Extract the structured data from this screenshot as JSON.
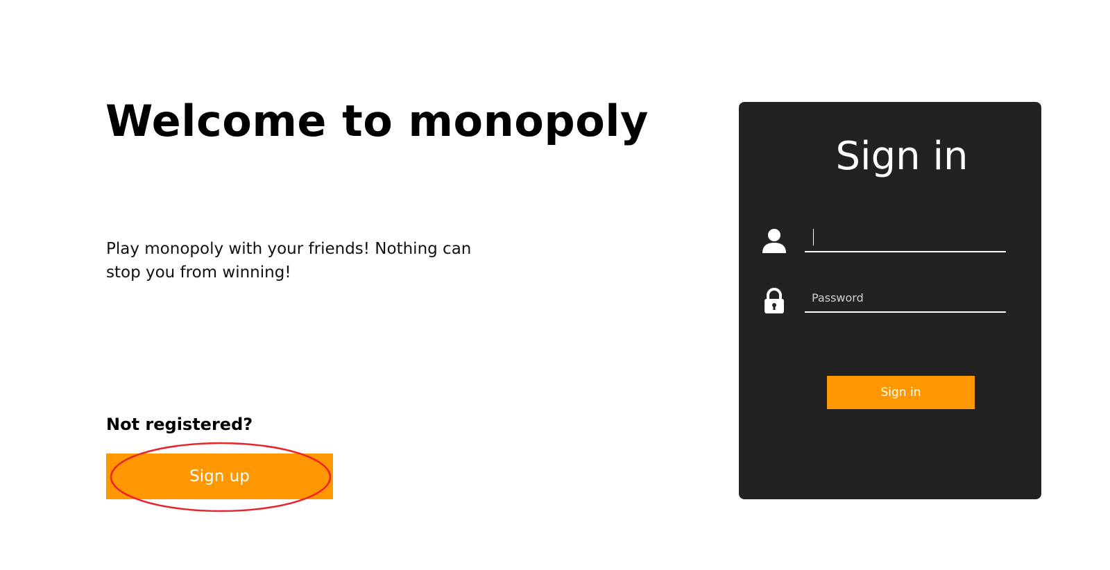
{
  "welcome": {
    "title": "Welcome to monopoly",
    "tagline": "Play monopoly with your friends! Nothing can stop you from winning!"
  },
  "register": {
    "prompt": "Not registered?",
    "signup_label": "Sign up",
    "button_color": "#ff9800",
    "annotation_color": "#e8232a"
  },
  "signin": {
    "title": "Sign in",
    "username": {
      "value": "",
      "placeholder": "",
      "icon": "user-icon"
    },
    "password": {
      "value": "",
      "placeholder": "Password",
      "icon": "lock-icon"
    },
    "submit_label": "Sign in",
    "card_color": "#222222"
  }
}
